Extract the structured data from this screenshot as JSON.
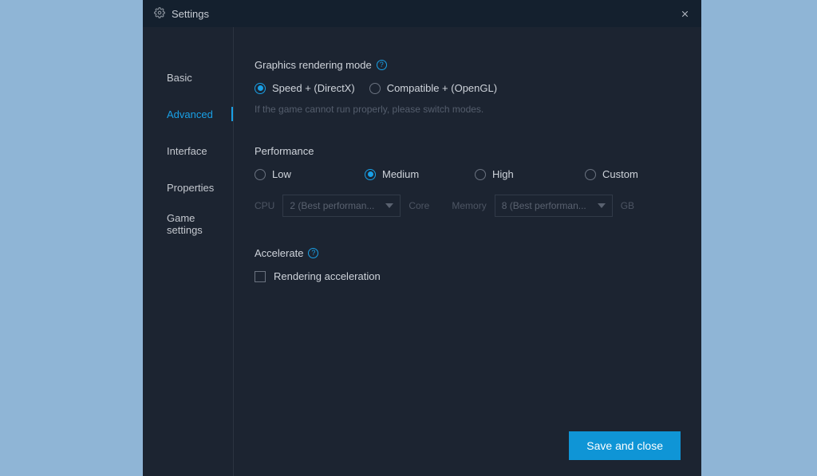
{
  "window": {
    "title": "Settings"
  },
  "sidebar": {
    "items": [
      {
        "label": "Basic"
      },
      {
        "label": "Advanced"
      },
      {
        "label": "Interface"
      },
      {
        "label": "Properties"
      },
      {
        "label": "Game settings"
      }
    ],
    "active_index": 1
  },
  "sections": {
    "graphics": {
      "title": "Graphics rendering mode",
      "options": [
        {
          "label": "Speed + (DirectX)"
        },
        {
          "label": "Compatible + (OpenGL)"
        }
      ],
      "selected_index": 0,
      "hint": "If the game cannot run properly, please switch modes."
    },
    "performance": {
      "title": "Performance",
      "levels": [
        {
          "label": "Low"
        },
        {
          "label": "Medium"
        },
        {
          "label": "High"
        },
        {
          "label": "Custom"
        }
      ],
      "selected_index": 1,
      "cpu_label": "CPU",
      "cpu_value": "2 (Best performan...",
      "core_label": "Core",
      "memory_label": "Memory",
      "memory_value": "8 (Best performan...",
      "gb_label": "GB"
    },
    "accelerate": {
      "title": "Accelerate",
      "checkbox_label": "Rendering acceleration",
      "checked": false
    }
  },
  "footer": {
    "save_label": "Save and close"
  }
}
